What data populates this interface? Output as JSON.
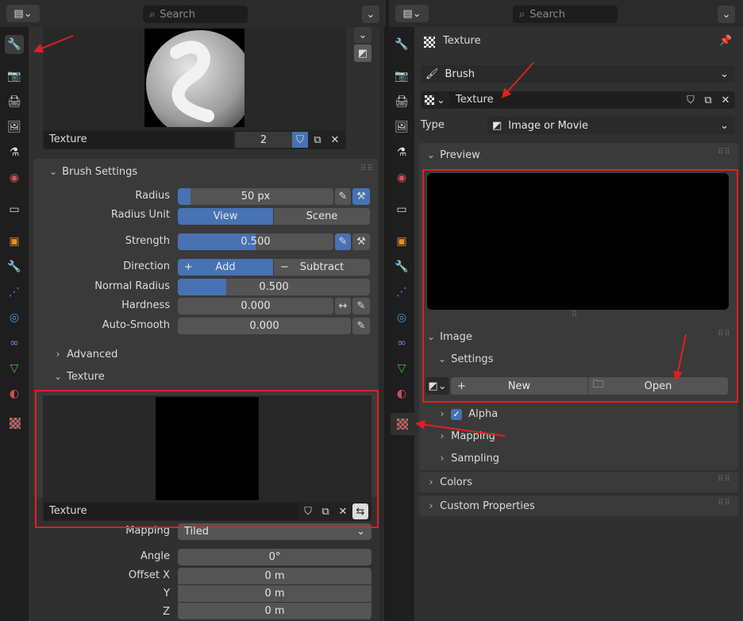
{
  "left": {
    "header": {
      "search_placeholder": "Search"
    },
    "texture_slot": {
      "name": "Texture",
      "users": "2"
    },
    "brush_settings": {
      "title": "Brush Settings",
      "radius": {
        "label": "Radius",
        "value": "50 px",
        "fill_fraction": 0.08
      },
      "radius_unit": {
        "label": "Radius Unit",
        "options": [
          "View",
          "Scene"
        ],
        "selected": "View"
      },
      "strength": {
        "label": "Strength",
        "value": "0.500",
        "fill_fraction": 0.5
      },
      "direction": {
        "label": "Direction",
        "add": "Add",
        "subtract": "Subtract",
        "selected": "Add"
      },
      "normal_radius": {
        "label": "Normal Radius",
        "value": "0.500",
        "fill_fraction": 0.25
      },
      "hardness": {
        "label": "Hardness",
        "value": "0.000"
      },
      "auto_smooth": {
        "label": "Auto-Smooth",
        "value": "0.000"
      }
    },
    "advanced": "Advanced",
    "texture_section": {
      "title": "Texture",
      "slot_name": "Texture"
    },
    "mapping": {
      "label": "Mapping",
      "value": "Tiled"
    },
    "angle": {
      "label": "Angle",
      "value": "0°"
    },
    "offset_x": {
      "label": "Offset X",
      "value": "0 m"
    },
    "offset_y": {
      "label": "Y",
      "value": "0 m"
    },
    "offset_z": {
      "label": "Z",
      "value": "0 m"
    }
  },
  "right": {
    "header": {
      "search_placeholder": "Search"
    },
    "context_title": "Texture",
    "brush": "Brush",
    "texture_name": "Texture",
    "type": {
      "label": "Type",
      "value": "Image or Movie"
    },
    "preview": "Preview",
    "image": "Image",
    "settings": "Settings",
    "new_label": "New",
    "open_label": "Open",
    "alpha": {
      "label": "Alpha",
      "checked": true
    },
    "mapping": "Mapping",
    "sampling": "Sampling",
    "colors": "Colors",
    "custom_properties": "Custom Properties"
  },
  "colors": {
    "accent": "#4772b3",
    "annotation": "#e02020"
  }
}
